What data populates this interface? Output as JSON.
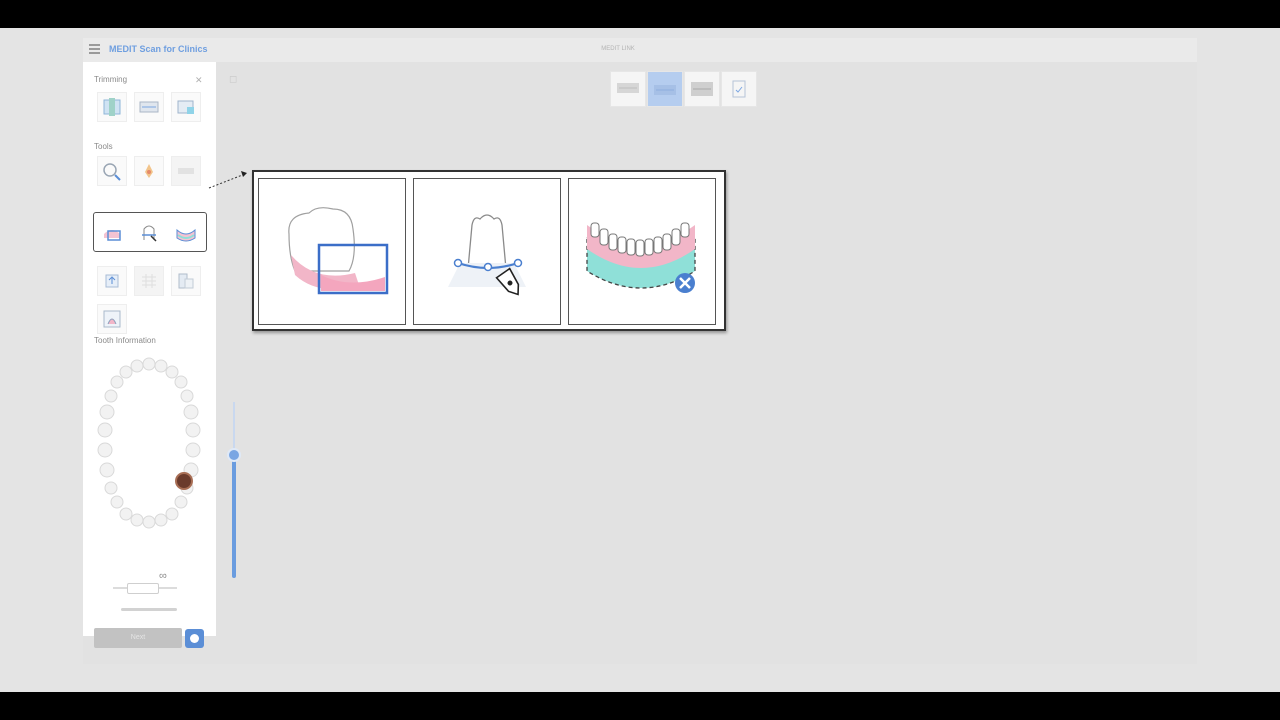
{
  "app": {
    "title": "MEDIT Scan for Clinics",
    "window_caption": "MEDIT LINK"
  },
  "sidebar": {
    "sections": {
      "trimming": "Trimming",
      "tools": "Tools",
      "tooth_information": "Tooth Information"
    },
    "trimming_tools": [
      "lock-tooth-icon",
      "trim-area-icon",
      "select-area-icon"
    ],
    "tools_row1": [
      "zoom-area-icon",
      "brush-icon",
      "disabled-tool-icon"
    ],
    "tools_row2": [
      "trim-rectangle-icon",
      "trim-pen-icon",
      "remove-data-icon"
    ],
    "tools_row3": [
      "upload-icon",
      "disabled-grid-icon",
      "layers-icon"
    ],
    "tools_row4": [
      "scan-image-icon"
    ],
    "next_button_label": "Next"
  },
  "toolbar": {
    "stages": [
      "maxilla",
      "mandible",
      "occlusion",
      "review"
    ],
    "active_stage": "mandible"
  },
  "slider": {
    "level": 0.62
  },
  "callout": {
    "items": [
      "trim-rectangle-illustration",
      "trim-pen-illustration",
      "remove-data-illustration"
    ]
  },
  "colors": {
    "accent": "#5b8ed6",
    "highlight_blue": "#b5cdef",
    "gum_pink": "#f2b6c8",
    "teal": "#8fe0d8"
  }
}
